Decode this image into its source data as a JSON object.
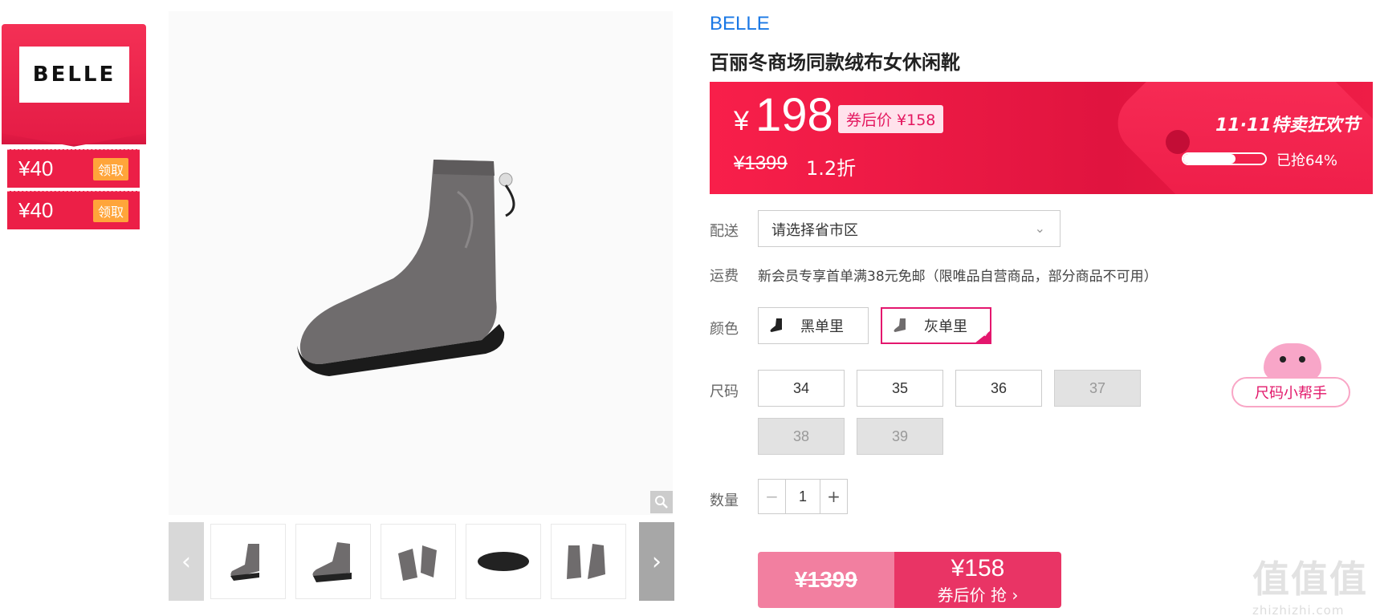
{
  "brand_card": {
    "logo_text": "BELLE"
  },
  "coupons": [
    {
      "amount": "¥40",
      "action": "领取"
    },
    {
      "amount": "¥40",
      "action": "领取"
    }
  ],
  "product": {
    "brand": "BELLE",
    "title": "百丽冬商场同款绒布女休闲靴"
  },
  "price_banner": {
    "currency": "¥",
    "price": "198",
    "after_coupon_label": "券后价 ¥158",
    "original_price": "¥1399",
    "discount": "1.2折",
    "festival": "11·11特卖狂欢节",
    "sold_text": "已抢64%",
    "sold_fraction": 0.64
  },
  "delivery": {
    "label": "配送",
    "placeholder": "请选择省市区"
  },
  "shipping": {
    "label": "运费",
    "text": "新会员专享首单满38元免邮（限唯品自营商品，部分商品不可用）"
  },
  "color": {
    "label": "颜色",
    "options": [
      {
        "name": "黑单里",
        "selected": false
      },
      {
        "name": "灰单里",
        "selected": true
      }
    ]
  },
  "size": {
    "label": "尺码",
    "options": [
      {
        "value": "34",
        "available": true
      },
      {
        "value": "35",
        "available": true
      },
      {
        "value": "36",
        "available": true
      },
      {
        "value": "37",
        "available": false
      },
      {
        "value": "38",
        "available": false
      },
      {
        "value": "39",
        "available": false
      }
    ],
    "helper": "尺码小帮手"
  },
  "quantity": {
    "label": "数量",
    "value": "1",
    "minus": "−",
    "plus": "+"
  },
  "buy": {
    "original": "¥1399",
    "price": "¥158",
    "action": "券后价 抢 ›"
  },
  "watermark": {
    "big": "值值值",
    "small": "zhizhizhi.com"
  }
}
